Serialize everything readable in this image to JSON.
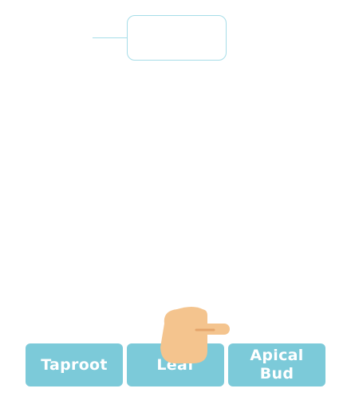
{
  "drop_target": {
    "value": ""
  },
  "answers": [
    {
      "label": "Taproot"
    },
    {
      "label": "Leaf"
    },
    {
      "label": "Apical Bud"
    }
  ],
  "hint": {
    "icon": "pointing-hand-icon",
    "skin_color": "#f4c48e",
    "shadow_color": "#e4a56b"
  },
  "colors": {
    "button": "#7ccad9",
    "slot_border": "#a6dde8"
  }
}
